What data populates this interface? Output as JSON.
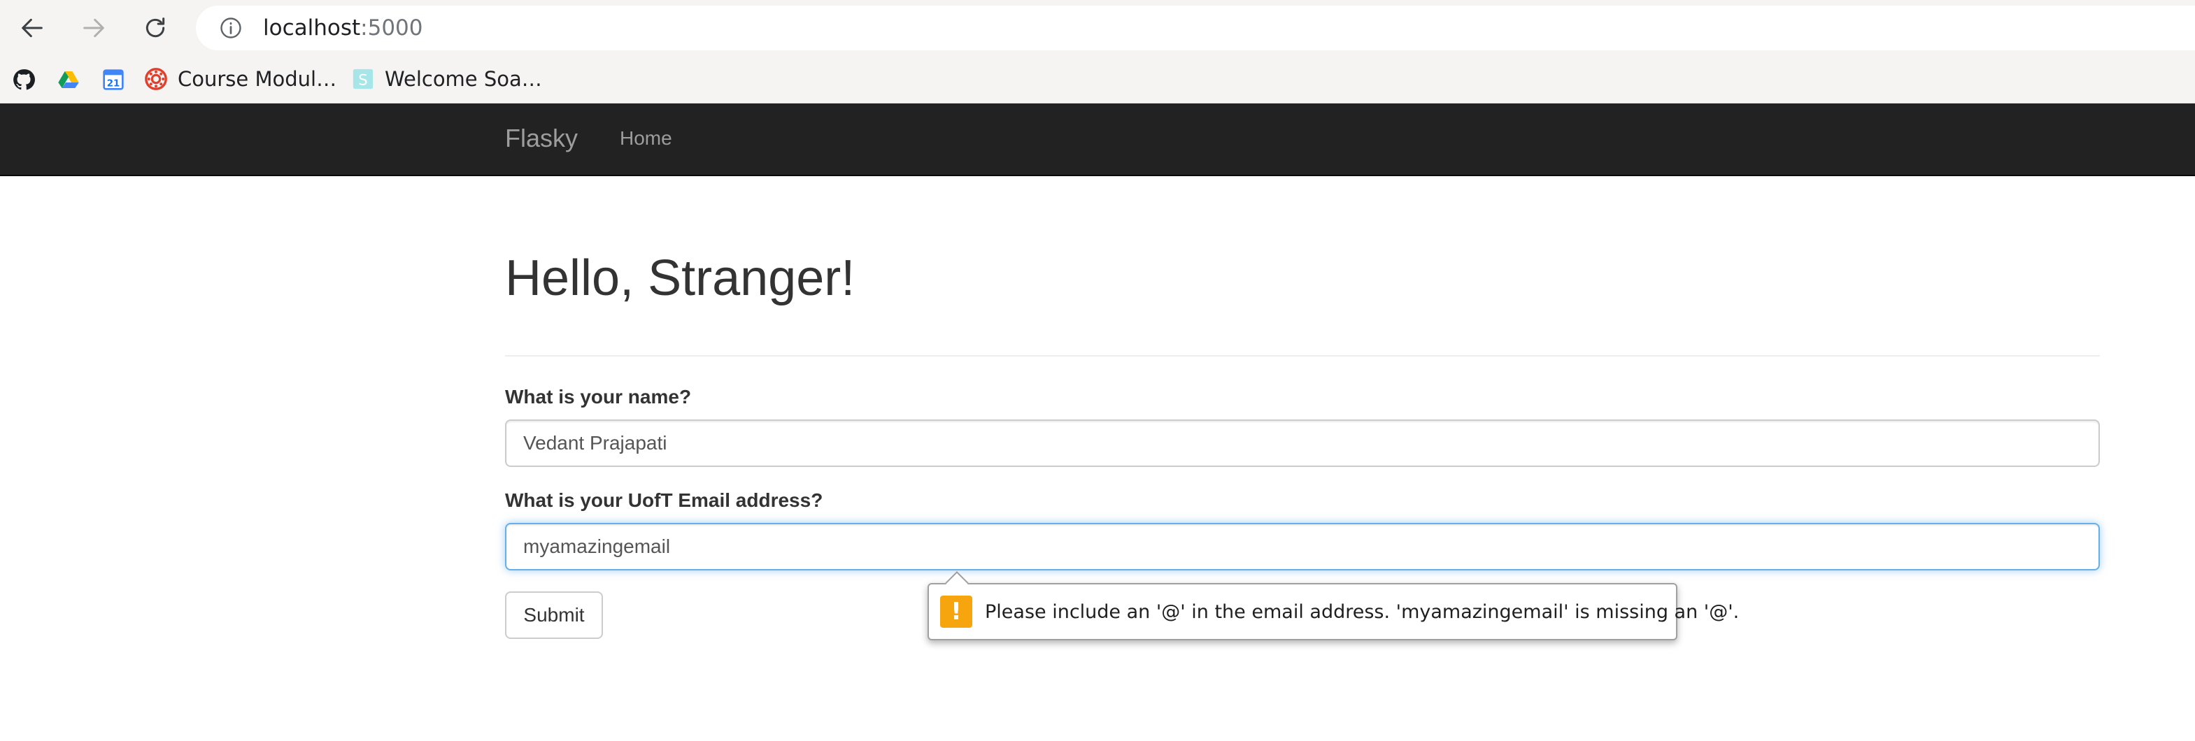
{
  "browser": {
    "url_host": "localhost",
    "url_port": ":5000",
    "bookmarks": [
      {
        "label": "Course Modul…",
        "icon": "canvas-icon"
      },
      {
        "label": "Welcome Soa…",
        "icon": "soa-icon"
      }
    ],
    "icon_bookmarks": [
      "github-icon",
      "google-drive-icon",
      "google-calendar-icon"
    ],
    "calendar_day": "21",
    "soa_letter": "S"
  },
  "navbar": {
    "brand": "Flasky",
    "home": "Home"
  },
  "page": {
    "title": "Hello, Stranger!"
  },
  "form": {
    "name_label": "What is your name?",
    "name_value": "Vedant Prajapati",
    "email_label": "What is your UofT Email address?",
    "email_value": "myamazingemail",
    "submit_label": "Submit"
  },
  "validation": {
    "icon": "!",
    "message": "Please include an '@' in the email address. 'myamazingemail' is missing an '@'."
  },
  "colors": {
    "navbar_bg": "#222222",
    "focus_border": "#66afe9",
    "warning": "#f6a50f"
  }
}
